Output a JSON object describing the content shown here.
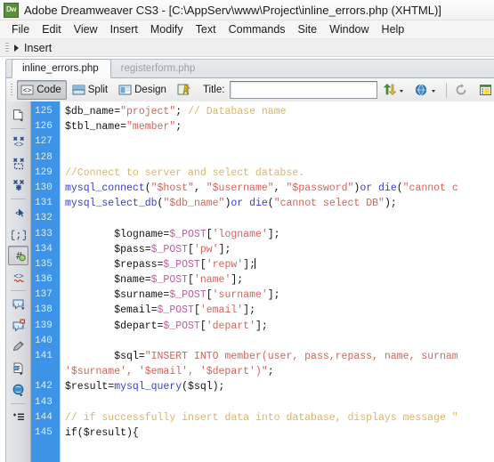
{
  "window": {
    "logo_text": "Dw",
    "title": "Adobe Dreamweaver CS3 - [C:\\AppServ\\www\\Project\\inline_errors.php (XHTML)]"
  },
  "menubar": {
    "items": [
      {
        "label": "File"
      },
      {
        "label": "Edit"
      },
      {
        "label": "View"
      },
      {
        "label": "Insert"
      },
      {
        "label": "Modify"
      },
      {
        "label": "Text"
      },
      {
        "label": "Commands"
      },
      {
        "label": "Site"
      },
      {
        "label": "Window"
      },
      {
        "label": "Help"
      }
    ]
  },
  "insert_panel": {
    "label": "Insert"
  },
  "tabs": [
    {
      "label": "inline_errors.php",
      "active": true
    },
    {
      "label": "registerform.php",
      "active": false
    }
  ],
  "toolbar": {
    "code_label": "Code",
    "split_label": "Split",
    "design_label": "Design",
    "live_view_icon": "live-data-icon",
    "title_label": "Title:",
    "title_value": "",
    "title_placeholder": "",
    "file_management_icon": "file-management-icon",
    "preview_icon": "preview-in-browser-icon",
    "refresh_icon": "refresh-design-view-icon",
    "view_options_icon": "view-options-icon"
  },
  "coding_toolbar": {
    "buttons": [
      {
        "name": "open-documents-icon",
        "pressed": false
      },
      {
        "name": "collapse-full-tag-icon",
        "pressed": false
      },
      {
        "name": "collapse-outside-selection-icon",
        "pressed": false
      },
      {
        "name": "expand-all-icon",
        "pressed": false
      },
      {
        "name": "select-parent-tag-icon",
        "pressed": false
      },
      {
        "name": "balance-braces-icon",
        "pressed": false
      },
      {
        "name": "line-numbers-icon",
        "pressed": true
      },
      {
        "name": "highlight-invalid-code-icon",
        "pressed": false
      },
      {
        "name": "apply-comment-icon",
        "pressed": false
      },
      {
        "name": "remove-comment-icon",
        "pressed": false
      },
      {
        "name": "wrap-tag-icon",
        "pressed": false
      },
      {
        "name": "recent-snippets-icon",
        "pressed": false
      },
      {
        "name": "indent-code-icon",
        "pressed": false
      },
      {
        "name": "format-source-code-icon",
        "pressed": false
      }
    ]
  },
  "editor": {
    "first_line_number": 125,
    "line_numbers": [
      "125",
      "126",
      "127",
      "128",
      "129",
      "130",
      "131",
      "132",
      "133",
      "134",
      "135",
      "136",
      "137",
      "138",
      "139",
      "140",
      "141",
      "",
      "142",
      "143",
      "144",
      "145"
    ],
    "lines": [
      {
        "num": "125",
        "segments": [
          {
            "t": "$db_name=",
            "c": "s-var"
          },
          {
            "t": "\"project\"",
            "c": "s-str"
          },
          {
            "t": "; ",
            "c": "s-var"
          },
          {
            "t": "// Database name",
            "c": "s-com"
          }
        ]
      },
      {
        "num": "126",
        "segments": [
          {
            "t": "$tbl_name=",
            "c": "s-var"
          },
          {
            "t": "\"member\"",
            "c": "s-str"
          },
          {
            "t": ";",
            "c": "s-var"
          }
        ]
      },
      {
        "num": "127",
        "segments": []
      },
      {
        "num": "128",
        "segments": []
      },
      {
        "num": "129",
        "segments": [
          {
            "t": "//Connect to server and select databse.",
            "c": "s-com"
          }
        ]
      },
      {
        "num": "130",
        "segments": [
          {
            "t": "mysql_connect",
            "c": "s-fn"
          },
          {
            "t": "(",
            "c": "s-var"
          },
          {
            "t": "\"$host\"",
            "c": "s-str"
          },
          {
            "t": ", ",
            "c": "s-var"
          },
          {
            "t": "\"$username\"",
            "c": "s-str"
          },
          {
            "t": ", ",
            "c": "s-var"
          },
          {
            "t": "\"$password\"",
            "c": "s-str"
          },
          {
            "t": ")",
            "c": "s-var"
          },
          {
            "t": "or die",
            "c": "s-fn"
          },
          {
            "t": "(",
            "c": "s-var"
          },
          {
            "t": "\"cannot c",
            "c": "s-str"
          }
        ]
      },
      {
        "num": "131",
        "segments": [
          {
            "t": "mysql_select_db",
            "c": "s-fn"
          },
          {
            "t": "(",
            "c": "s-var"
          },
          {
            "t": "\"$db_name\"",
            "c": "s-str"
          },
          {
            "t": ")",
            "c": "s-var"
          },
          {
            "t": "or ",
            "c": "s-fn"
          },
          {
            "t": "die",
            "c": "s-fn"
          },
          {
            "t": "(",
            "c": "s-var"
          },
          {
            "t": "\"cannot select DB\"",
            "c": "s-str"
          },
          {
            "t": ");",
            "c": "s-var"
          }
        ]
      },
      {
        "num": "132",
        "segments": []
      },
      {
        "num": "133",
        "segments": [
          {
            "t": "        $logname=",
            "c": "s-var"
          },
          {
            "t": "$_POST",
            "c": "s-post"
          },
          {
            "t": "[",
            "c": "s-var"
          },
          {
            "t": "'logname'",
            "c": "s-str"
          },
          {
            "t": "];",
            "c": "s-var"
          }
        ]
      },
      {
        "num": "134",
        "segments": [
          {
            "t": "        $pass=",
            "c": "s-var"
          },
          {
            "t": "$_POST",
            "c": "s-post"
          },
          {
            "t": "[",
            "c": "s-var"
          },
          {
            "t": "'pw'",
            "c": "s-str"
          },
          {
            "t": "];",
            "c": "s-var"
          }
        ]
      },
      {
        "num": "135",
        "segments": [
          {
            "t": "        $repass=",
            "c": "s-var"
          },
          {
            "t": "$_POST",
            "c": "s-post"
          },
          {
            "t": "[",
            "c": "s-var"
          },
          {
            "t": "'repw'",
            "c": "s-str"
          },
          {
            "t": "];",
            "c": "s-var"
          }
        ],
        "caret": true
      },
      {
        "num": "136",
        "segments": [
          {
            "t": "        $name=",
            "c": "s-var"
          },
          {
            "t": "$_POST",
            "c": "s-post"
          },
          {
            "t": "[",
            "c": "s-var"
          },
          {
            "t": "'name'",
            "c": "s-str"
          },
          {
            "t": "];",
            "c": "s-var"
          }
        ]
      },
      {
        "num": "137",
        "segments": [
          {
            "t": "        $surname=",
            "c": "s-var"
          },
          {
            "t": "$_POST",
            "c": "s-post"
          },
          {
            "t": "[",
            "c": "s-var"
          },
          {
            "t": "'surname'",
            "c": "s-str"
          },
          {
            "t": "];",
            "c": "s-var"
          }
        ]
      },
      {
        "num": "138",
        "segments": [
          {
            "t": "        $email=",
            "c": "s-var"
          },
          {
            "t": "$_POST",
            "c": "s-post"
          },
          {
            "t": "[",
            "c": "s-var"
          },
          {
            "t": "'email'",
            "c": "s-str"
          },
          {
            "t": "];",
            "c": "s-var"
          }
        ]
      },
      {
        "num": "139",
        "segments": [
          {
            "t": "        $depart=",
            "c": "s-var"
          },
          {
            "t": "$_POST",
            "c": "s-post"
          },
          {
            "t": "[",
            "c": "s-var"
          },
          {
            "t": "'depart'",
            "c": "s-str"
          },
          {
            "t": "];",
            "c": "s-var"
          }
        ]
      },
      {
        "num": "140",
        "segments": []
      },
      {
        "num": "141",
        "segments": [
          {
            "t": "        $sql=",
            "c": "s-var"
          },
          {
            "t": "\"INSERT INTO member(user, pass,repass, name, surnam",
            "c": "s-str"
          }
        ]
      },
      {
        "num": "",
        "segments": [
          {
            "t": "'$surname', '$email', '$depart')\"",
            "c": "s-str"
          },
          {
            "t": ";",
            "c": "s-var"
          }
        ]
      },
      {
        "num": "142",
        "segments": [
          {
            "t": "$result=",
            "c": "s-var"
          },
          {
            "t": "mysql_query",
            "c": "s-fn"
          },
          {
            "t": "(",
            "c": "s-var"
          },
          {
            "t": "$sql",
            "c": "s-var"
          },
          {
            "t": ");",
            "c": "s-var"
          }
        ]
      },
      {
        "num": "143",
        "segments": []
      },
      {
        "num": "144",
        "segments": [
          {
            "t": "// if successfully insert data into database, displays message \"",
            "c": "s-com"
          }
        ]
      },
      {
        "num": "145",
        "segments": [
          {
            "t": "if($result){",
            "c": "s-var"
          }
        ]
      }
    ]
  },
  "colors": {
    "gutter_blue": "#3d93e6",
    "string_red": "#d4635c",
    "comment_tan": "#d8b66a",
    "function_blue": "#3f3fc0",
    "post_magenta": "#c05aa0"
  }
}
